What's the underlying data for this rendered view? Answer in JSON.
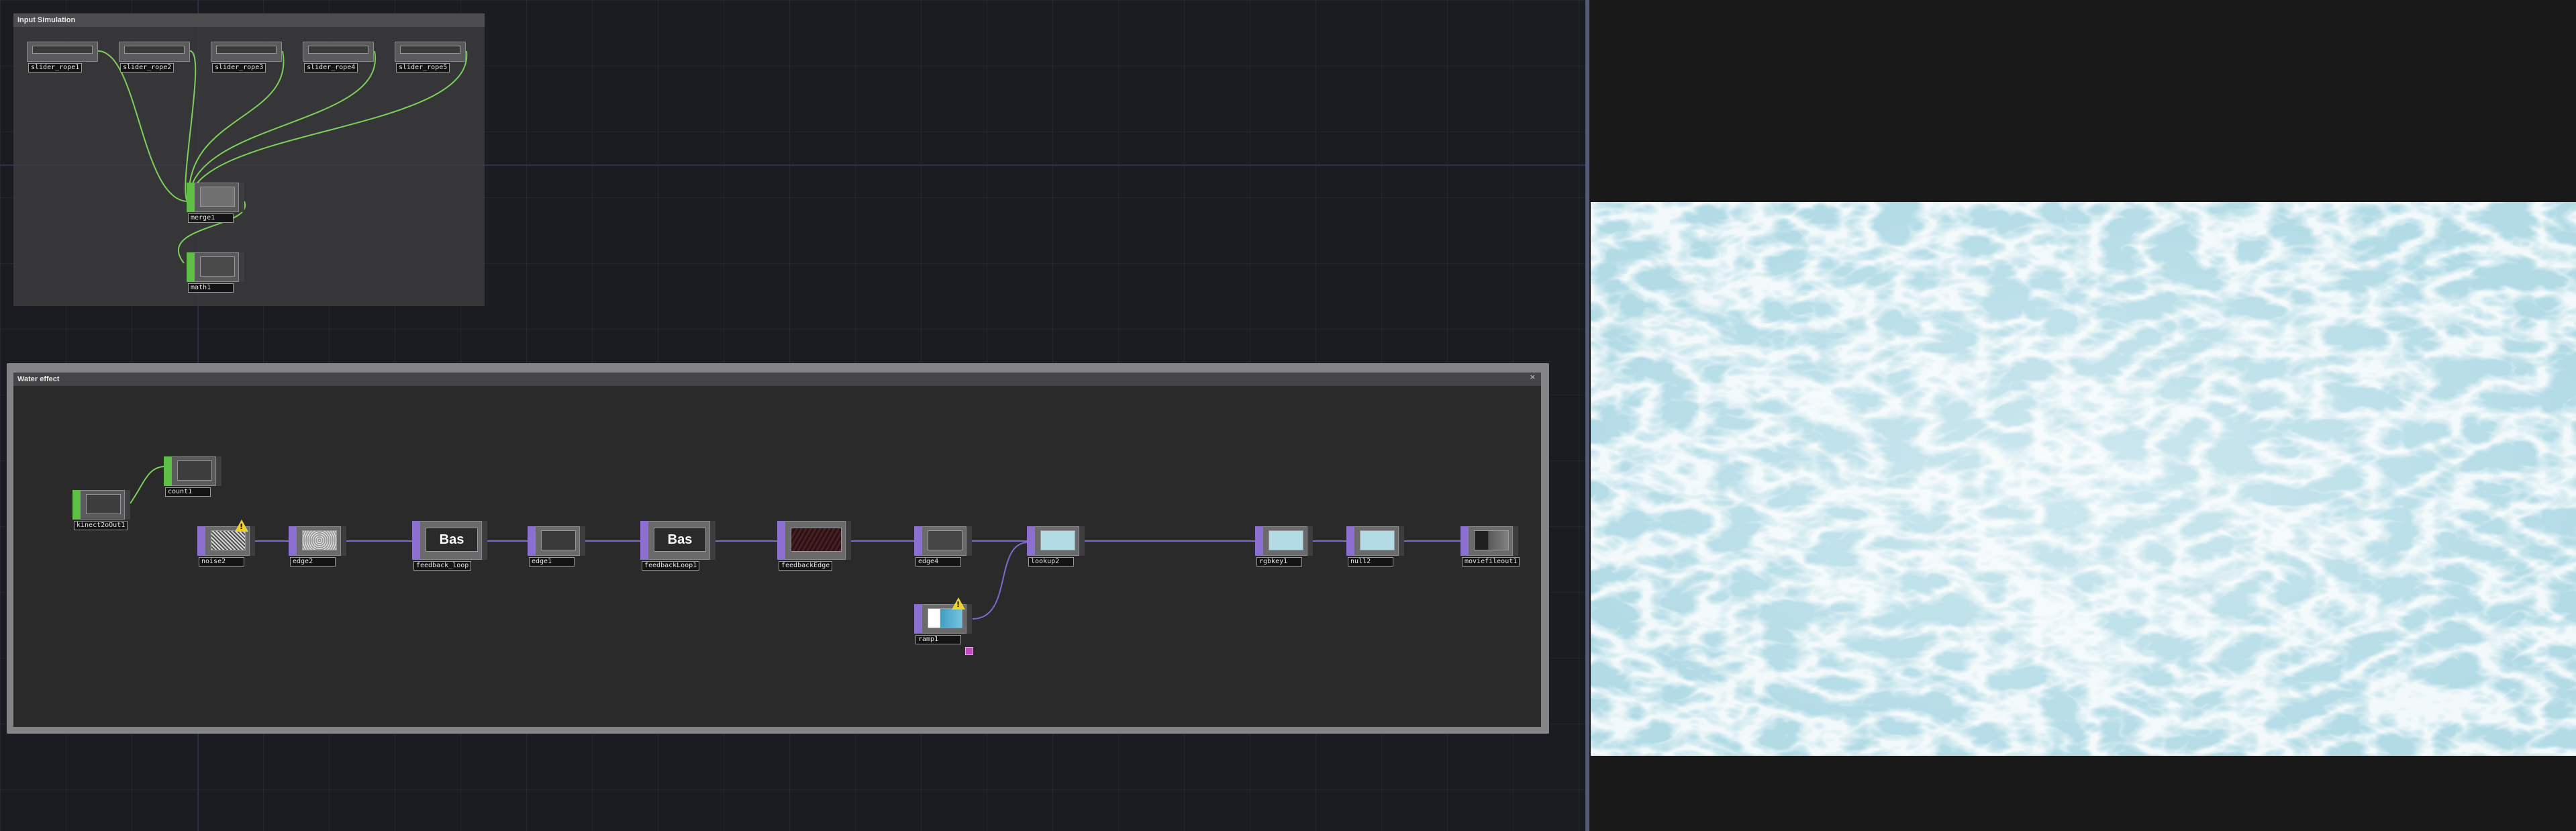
{
  "colors": {
    "chop_wire": "#7ccf5a",
    "top_wire": "#7a6cc8",
    "chop_node": "#5fbf47",
    "top_node": "#8b6fd1",
    "viewer_water": "#b2dbe6"
  },
  "input_simulation": {
    "title": "Input Simulation",
    "nodes": [
      {
        "label": "slider_rope1",
        "kind": "chop"
      },
      {
        "label": "slider_rope2",
        "kind": "chop"
      },
      {
        "label": "slider_rope3",
        "kind": "chop"
      },
      {
        "label": "slider_rope4",
        "kind": "chop"
      },
      {
        "label": "slider_rope5",
        "kind": "chop"
      },
      {
        "label": "merge1",
        "kind": "chop"
      },
      {
        "label": "math1",
        "kind": "chop"
      }
    ]
  },
  "water_effect": {
    "title": "Water effect",
    "close_icon": "×",
    "nodes": [
      {
        "label": "kinect2oOut1",
        "kind": "chop"
      },
      {
        "label": "count1",
        "kind": "chop"
      },
      {
        "label": "noise2",
        "kind": "top",
        "warning": "!"
      },
      {
        "label": "edge2",
        "kind": "top"
      },
      {
        "label": "feedback_loop",
        "kind": "top",
        "thumb_text": "Bas"
      },
      {
        "label": "edge1",
        "kind": "top"
      },
      {
        "label": "feedbackLoop1",
        "kind": "top",
        "thumb_text": "Bas"
      },
      {
        "label": "feedbackEdge",
        "kind": "top"
      },
      {
        "label": "edge4",
        "kind": "top"
      },
      {
        "label": "lookup2",
        "kind": "top"
      },
      {
        "label": "ramp1",
        "kind": "top",
        "warning": "!"
      },
      {
        "label": "rgbkey1",
        "kind": "top"
      },
      {
        "label": "null2",
        "kind": "top"
      },
      {
        "label": "moviefileout1",
        "kind": "top"
      }
    ]
  }
}
